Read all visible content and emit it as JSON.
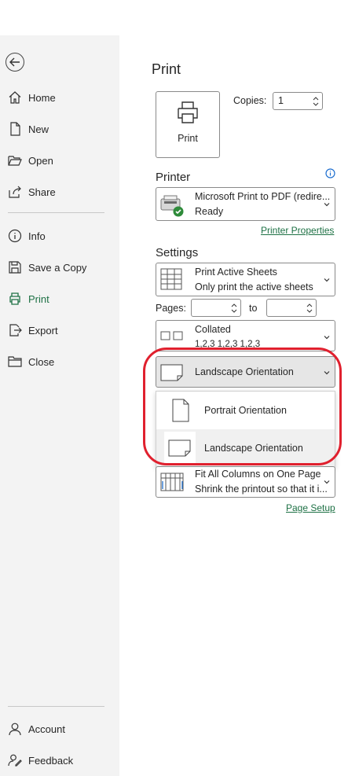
{
  "sidebar": {
    "back_label": "Back",
    "items": [
      {
        "label": "Home",
        "icon": "home-icon"
      },
      {
        "label": "New",
        "icon": "new-document-icon"
      },
      {
        "label": "Open",
        "icon": "folder-open-icon"
      },
      {
        "label": "Share",
        "icon": "share-icon"
      },
      {
        "label": "Info",
        "icon": "info-icon"
      },
      {
        "label": "Save a Copy",
        "icon": "save-icon"
      },
      {
        "label": "Print",
        "icon": "print-icon",
        "active": true
      },
      {
        "label": "Export",
        "icon": "export-icon"
      },
      {
        "label": "Close",
        "icon": "close-folder-icon"
      }
    ],
    "bottom_items": [
      {
        "label": "Account",
        "icon": "account-icon"
      },
      {
        "label": "Feedback",
        "icon": "feedback-icon"
      }
    ]
  },
  "main": {
    "title": "Print",
    "print_button_label": "Print",
    "copies_label": "Copies:",
    "copies_value": "1",
    "printer_section": "Printer",
    "printer_name": "Microsoft Print to PDF (redire...",
    "printer_status": "Ready",
    "printer_properties_link": "Printer Properties",
    "settings_section": "Settings",
    "scope_title": "Print Active Sheets",
    "scope_desc": "Only print the active sheets",
    "pages_label": "Pages:",
    "pages_from": "",
    "to_label": "to",
    "pages_to": "",
    "collation_title": "Collated",
    "collation_desc": "1,2,3    1,2,3    1,2,3",
    "orientation_selected": "Landscape Orientation",
    "orientation_options": [
      "Portrait Orientation",
      "Landscape Orientation"
    ],
    "scaling_title": "Fit All Columns on One Page",
    "scaling_desc": "Shrink the printout so that it i...",
    "page_setup_link": "Page Setup"
  },
  "colors": {
    "accent_green": "#1e7145",
    "highlight_red": "#e0202e",
    "sidebar_bg": "#f3f3f3"
  }
}
